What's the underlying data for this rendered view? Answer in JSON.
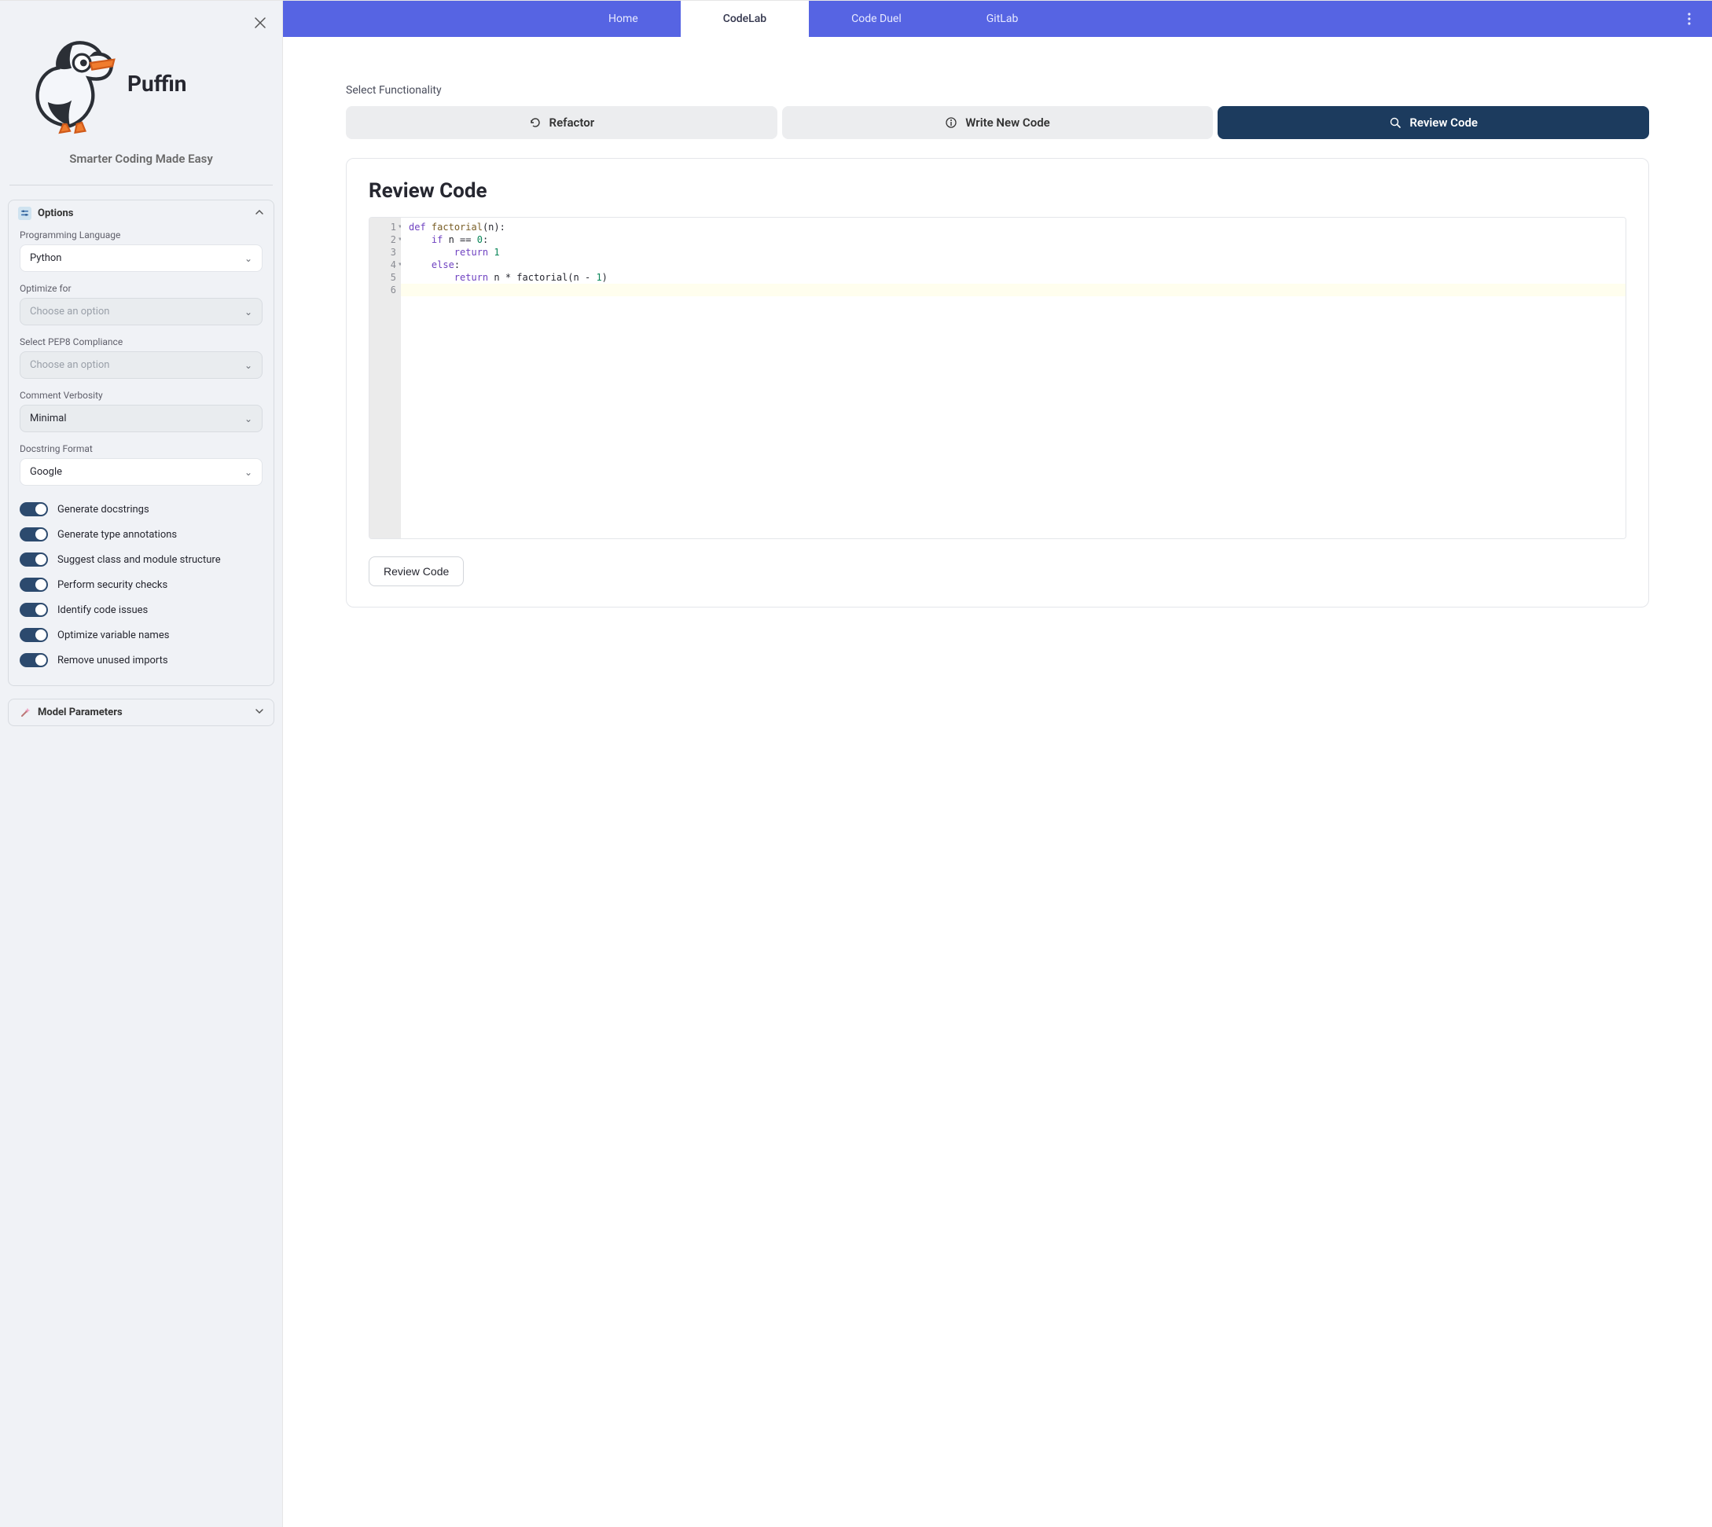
{
  "app": {
    "name": "Puffin",
    "tagline": "Smarter Coding Made Easy"
  },
  "sidebar": {
    "options_panel": {
      "title": "Options",
      "expanded": true,
      "fields": {
        "language": {
          "label": "Programming Language",
          "value": "Python"
        },
        "optimize": {
          "label": "Optimize for",
          "placeholder": "Choose an option"
        },
        "pep8": {
          "label": "Select PEP8 Compliance",
          "placeholder": "Choose an option"
        },
        "verbosity": {
          "label": "Comment Verbosity",
          "value": "Minimal"
        },
        "docstring": {
          "label": "Docstring Format",
          "value": "Google"
        }
      },
      "toggles": [
        {
          "label": "Generate docstrings",
          "on": true
        },
        {
          "label": "Generate type annotations",
          "on": true
        },
        {
          "label": "Suggest class and module structure",
          "on": true
        },
        {
          "label": "Perform security checks",
          "on": true
        },
        {
          "label": "Identify code issues",
          "on": true
        },
        {
          "label": "Optimize variable names",
          "on": true
        },
        {
          "label": "Remove unused imports",
          "on": true
        }
      ]
    },
    "model_panel": {
      "title": "Model Parameters",
      "expanded": false
    }
  },
  "topbar": {
    "tabs": [
      {
        "label": "Home",
        "active": false
      },
      {
        "label": "CodeLab",
        "active": true
      },
      {
        "label": "Code Duel",
        "active": false
      },
      {
        "label": "GitLab",
        "active": false
      }
    ]
  },
  "content": {
    "section_label": "Select Functionality",
    "segments": [
      {
        "label": "Refactor",
        "icon": "refresh",
        "active": false
      },
      {
        "label": "Write New Code",
        "icon": "info",
        "active": false
      },
      {
        "label": "Review Code",
        "icon": "search",
        "active": true
      }
    ],
    "card_title": "Review Code",
    "action_button": "Review Code",
    "code": {
      "lines": [
        {
          "n": 1,
          "fold": true,
          "html": "<span class='tok-kw'>def</span> <span class='tok-fn'>factorial</span>(n):"
        },
        {
          "n": 2,
          "fold": true,
          "html": "    <span class='tok-kw'>if</span> n == <span class='tok-num'>0</span>:"
        },
        {
          "n": 3,
          "fold": false,
          "html": "        <span class='tok-kw'>return</span> <span class='tok-num'>1</span>"
        },
        {
          "n": 4,
          "fold": true,
          "html": "    <span class='tok-kw'>else</span>:"
        },
        {
          "n": 5,
          "fold": false,
          "html": "        <span class='tok-kw'>return</span> n * factorial(n - <span class='tok-num'>1</span>)"
        },
        {
          "n": 6,
          "fold": false,
          "html": "",
          "active": true
        }
      ]
    }
  }
}
